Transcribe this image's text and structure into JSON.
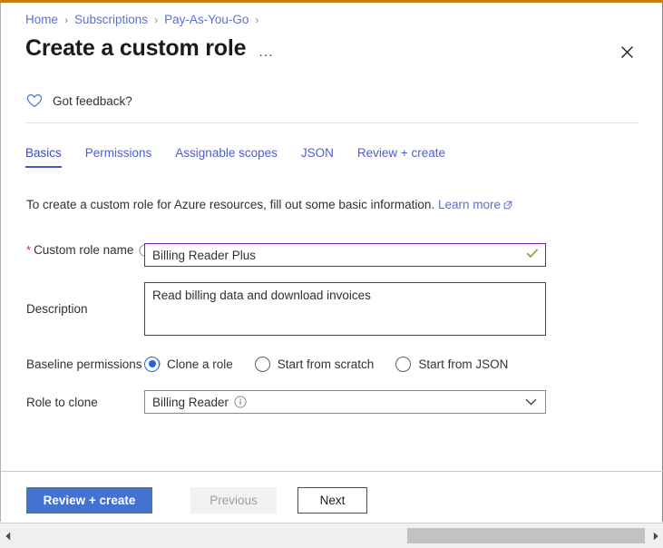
{
  "window": {
    "accent_color": "#c87e0e",
    "close_label": "Close",
    "ellipsis_label": "..."
  },
  "breadcrumb": {
    "items": [
      {
        "label": "Home"
      },
      {
        "label": "Subscriptions"
      },
      {
        "label": "Pay-As-You-Go"
      }
    ],
    "separator": "›"
  },
  "header": {
    "title": "Create a custom role"
  },
  "feedback": {
    "label": "Got feedback?",
    "icon": "heart-icon"
  },
  "tabs": [
    {
      "label": "Basics",
      "active": true
    },
    {
      "label": "Permissions",
      "active": false
    },
    {
      "label": "Assignable scopes",
      "active": false
    },
    {
      "label": "JSON",
      "active": false
    },
    {
      "label": "Review + create",
      "active": false
    }
  ],
  "intro": {
    "text": "To create a custom role for Azure resources, fill out some basic information.",
    "link_label": "Learn more"
  },
  "form": {
    "role_name": {
      "label": "Custom role name",
      "required_marker": "*",
      "value": "Billing Reader Plus",
      "placeholder": "",
      "validation": "valid",
      "border_color": "#7719aa",
      "check_color": "#7ba428"
    },
    "description": {
      "label": "Description",
      "value": "Read billing data and download invoices",
      "placeholder": "",
      "border_color": "#7719aa"
    },
    "baseline_permissions": {
      "label": "Baseline permissions",
      "options": [
        {
          "label": "Clone a role",
          "selected": true
        },
        {
          "label": "Start from scratch",
          "selected": false
        },
        {
          "label": "Start from JSON",
          "selected": false
        }
      ],
      "selected_color": "#2266dd"
    },
    "role_to_clone": {
      "label": "Role to clone",
      "value": "Billing Reader",
      "options": [
        "Billing Reader"
      ]
    }
  },
  "footer": {
    "review_create_label": "Review + create",
    "previous_label": "Previous",
    "next_label": "Next",
    "primary_color": "#4472d0"
  },
  "scrollbar": {
    "left_arrow": "◀",
    "right_arrow": "▶",
    "thumb_position_pct": 62,
    "thumb_width_pct": 37.5
  }
}
